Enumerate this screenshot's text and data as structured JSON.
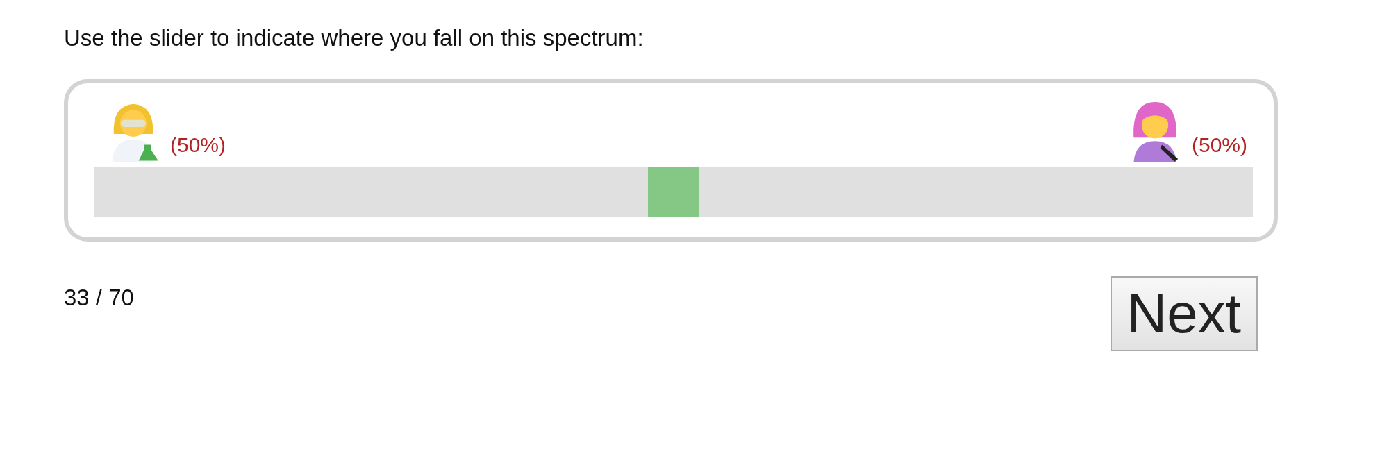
{
  "prompt": "Use the slider to indicate where you fall on this spectrum:",
  "spectrum": {
    "left": {
      "label": "(50%)"
    },
    "right": {
      "label": "(50%)"
    },
    "slider": {
      "level": 0.5
    }
  },
  "progress": "33 / 70",
  "next_button": "Next"
}
